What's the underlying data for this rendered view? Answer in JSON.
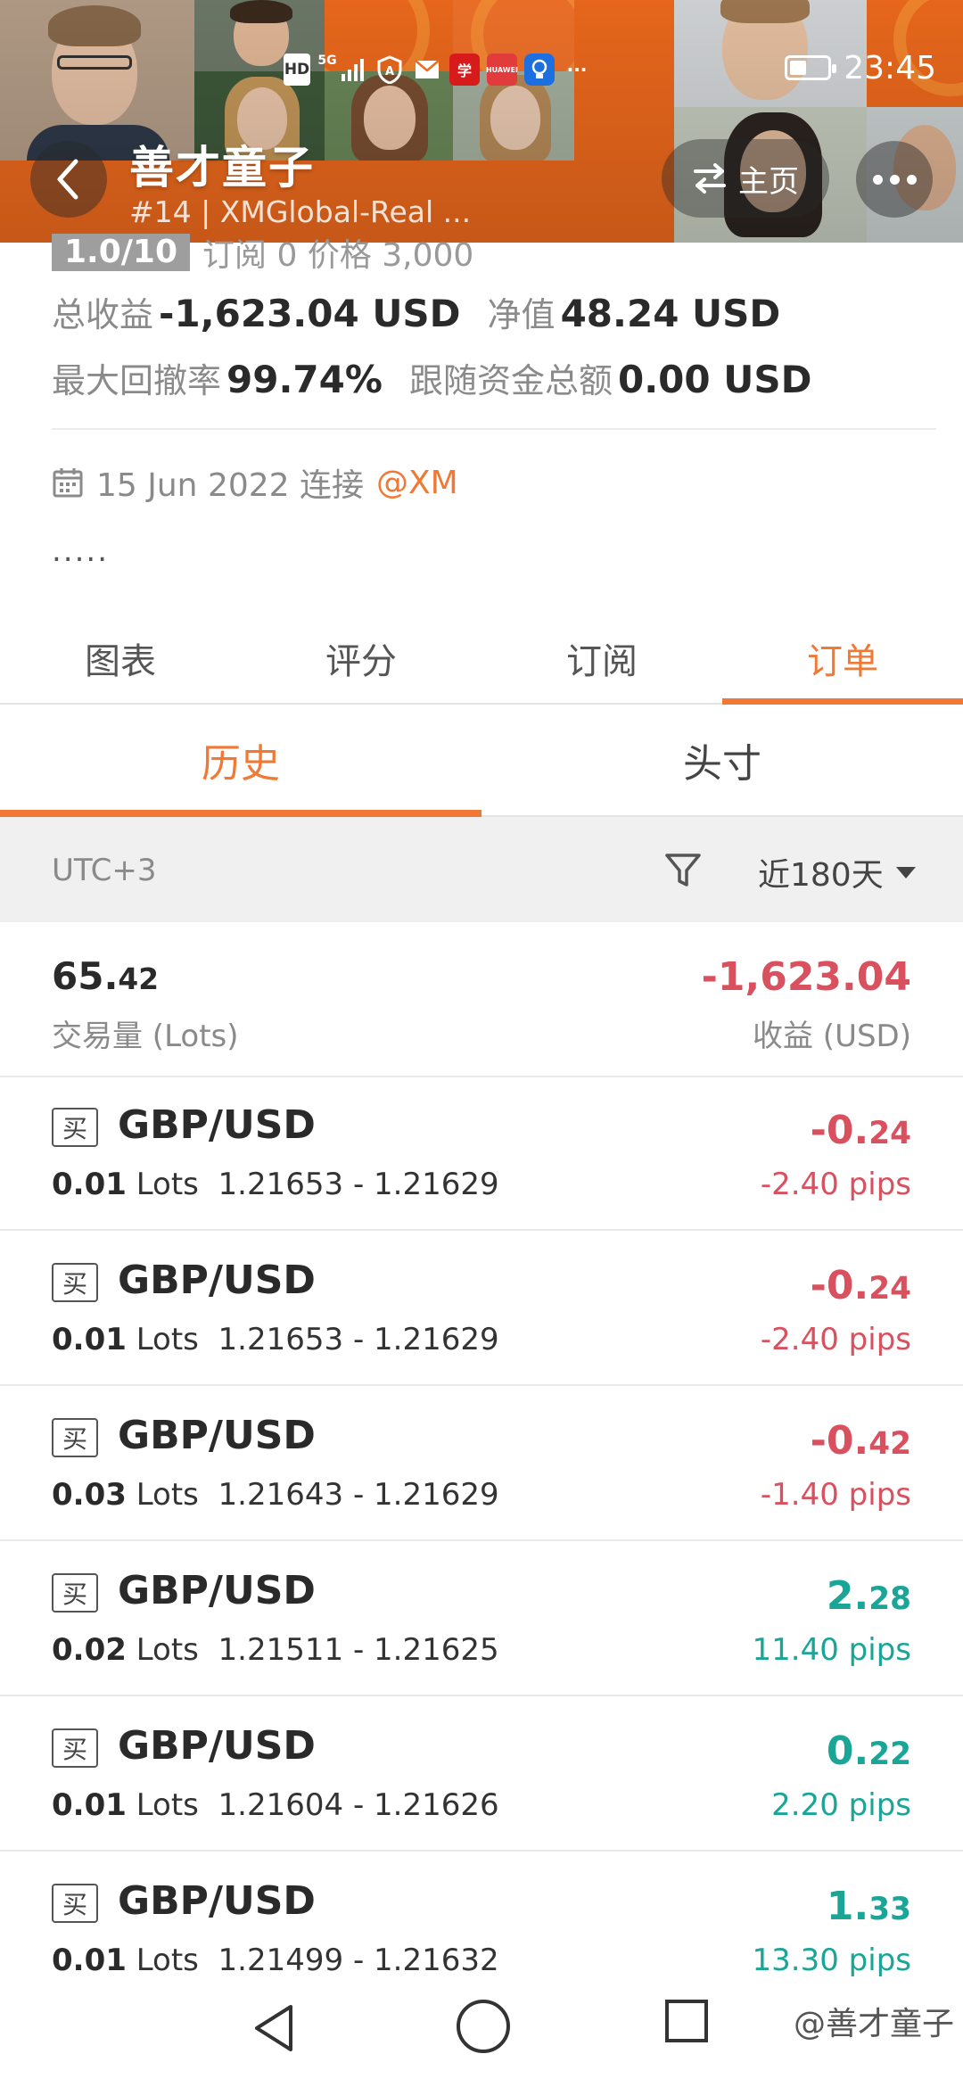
{
  "status_bar": {
    "time": "23:45",
    "icons": [
      "HD",
      "5G",
      "signal-icon",
      "shield-icon",
      "mail-icon",
      "app-icon",
      "huawei-icon",
      "bulb-icon",
      "more-icon"
    ],
    "hd_label": "HD",
    "net_label": "5G",
    "huawei_label": "HUAWEI",
    "overflow_label": "···"
  },
  "header": {
    "name": "善才童子",
    "sub_id": "#14 | XMGlobal-Real ...",
    "home_label": "主页"
  },
  "stats": {
    "partial_ratio": "1.0/10",
    "partial_text": "订阅 0   价格 3,000",
    "total_profit_label": "总收益",
    "total_profit_value": "-1,623.04 USD",
    "equity_label": "净值",
    "equity_value": "48.24 USD",
    "max_drawdown_label": "最大回撤率",
    "max_drawdown_value": "99.74%",
    "follow_total_label": "跟随资金总额",
    "follow_total_value": "0.00 USD",
    "connect_date": "15 Jun 2022 连接",
    "connect_broker": "@XM",
    "bio": "....."
  },
  "tabs": [
    "图表",
    "评分",
    "订阅",
    "订单"
  ],
  "subtabs": [
    "历史",
    "头寸"
  ],
  "filter": {
    "timezone": "UTC+3",
    "range": "近180天"
  },
  "summary": {
    "volume_int": "65.",
    "volume_dec": "42",
    "volume_label": "交易量 (Lots)",
    "profit_int": "-1,623.",
    "profit_dec": "04",
    "profit_label": "收益 (USD)"
  },
  "orders": [
    {
      "side": "买",
      "symbol": "GBP/USD",
      "lots": "0.01",
      "lots_unit": "Lots",
      "prices": "1.21653 - 1.21629",
      "pnl_int": "-0.",
      "pnl_dec": "24",
      "pips": "-2.40 pips",
      "dir": "neg"
    },
    {
      "side": "买",
      "symbol": "GBP/USD",
      "lots": "0.01",
      "lots_unit": "Lots",
      "prices": "1.21653 - 1.21629",
      "pnl_int": "-0.",
      "pnl_dec": "24",
      "pips": "-2.40 pips",
      "dir": "neg"
    },
    {
      "side": "买",
      "symbol": "GBP/USD",
      "lots": "0.03",
      "lots_unit": "Lots",
      "prices": "1.21643 - 1.21629",
      "pnl_int": "-0.",
      "pnl_dec": "42",
      "pips": "-1.40 pips",
      "dir": "neg"
    },
    {
      "side": "买",
      "symbol": "GBP/USD",
      "lots": "0.02",
      "lots_unit": "Lots",
      "prices": "1.21511 - 1.21625",
      "pnl_int": "2.",
      "pnl_dec": "28",
      "pips": "11.40 pips",
      "dir": "pos"
    },
    {
      "side": "买",
      "symbol": "GBP/USD",
      "lots": "0.01",
      "lots_unit": "Lots",
      "prices": "1.21604 - 1.21626",
      "pnl_int": "0.",
      "pnl_dec": "22",
      "pips": "2.20 pips",
      "dir": "pos"
    },
    {
      "side": "买",
      "symbol": "GBP/USD",
      "lots": "0.01",
      "lots_unit": "Lots",
      "prices": "1.21499 - 1.21632",
      "pnl_int": "1.",
      "pnl_dec": "33",
      "pips": "13.30 pips",
      "dir": "pos"
    }
  ],
  "watermark": "@善才童子",
  "colors": {
    "accent": "#f07a35",
    "negative": "#d9505f",
    "positive": "#1aa597",
    "banner": "#f26b1d"
  }
}
